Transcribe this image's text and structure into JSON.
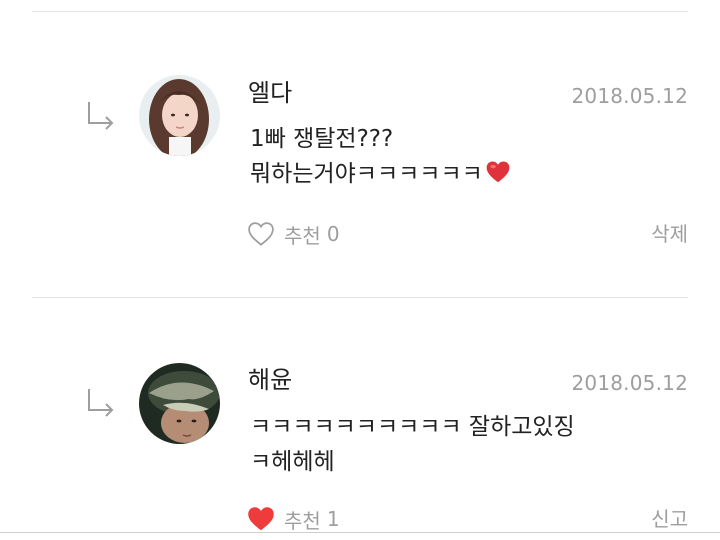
{
  "comments": [
    {
      "author": "엘다",
      "date": "2018.05.12",
      "line1": "1빠 쟁탈전???",
      "line2": "뭐하는거야ㅋㅋㅋㅋㅋㅋ",
      "line2_emoji": "heart-emoji",
      "like_label": "추천",
      "like_count": "0",
      "liked": false,
      "action_label": "삭제"
    },
    {
      "author": "해윤",
      "date": "2018.05.12",
      "line1": "ㅋㅋㅋㅋㅋㅋㅋㅋㅋㅋ 잘하고있징",
      "line2": "ㅋ헤헤헤",
      "like_label": "추천",
      "like_count": "1",
      "liked": true,
      "action_label": "신고"
    }
  ],
  "colors": {
    "heart_filled": "#ee3b3b",
    "muted_text": "#9e9e9e",
    "divider": "#e4e4e4"
  }
}
